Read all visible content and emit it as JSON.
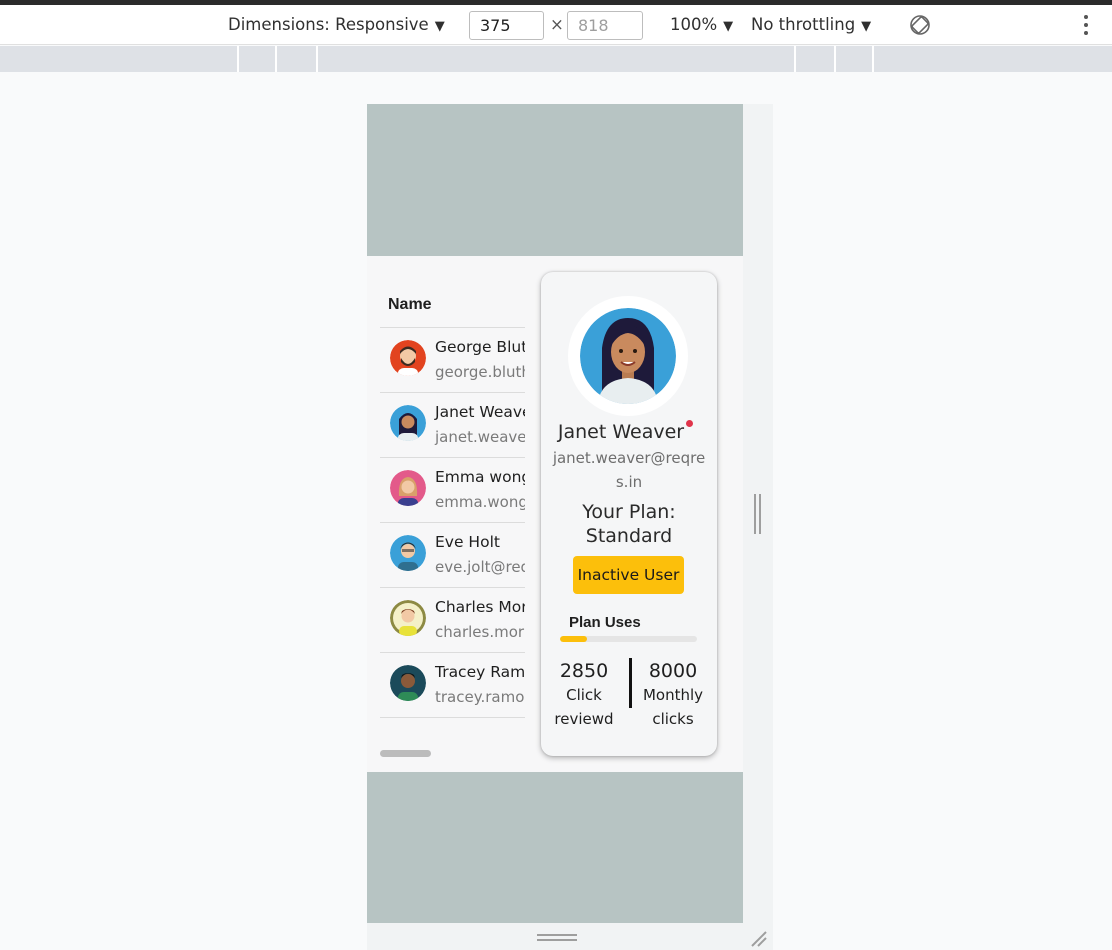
{
  "devtools": {
    "dimensions_label": "Dimensions: Responsive",
    "width_value": "375",
    "height_placeholder": "818",
    "times_symbol": "×",
    "zoom": "100%",
    "throttling": "No throttling",
    "caret": "▼"
  },
  "table": {
    "header_name": "Name",
    "rows": [
      {
        "name": "George Bluth",
        "email": "george.bluth@reqres.in",
        "avatar_color": "#e2431f",
        "icon": "avatar-george"
      },
      {
        "name": "Janet Weaver",
        "email": "janet.weaver@reqres.in",
        "avatar_color": "#3aa0d8",
        "icon": "avatar-janet"
      },
      {
        "name": "Emma wong",
        "email": "emma.wong@reqres.in",
        "avatar_color": "#e35a8a",
        "icon": "avatar-emma"
      },
      {
        "name": "Eve Holt",
        "email": "eve.jolt@reqres.in",
        "avatar_color": "#3aa0d8",
        "icon": "avatar-eve"
      },
      {
        "name": "Charles Morris",
        "email": "charles.morris@reqres.in",
        "avatar_color": "#8d8a43",
        "icon": "avatar-charles"
      },
      {
        "name": "Tracey Ramos",
        "email": "tracey.ramos@reqres.in",
        "avatar_color": "#1b4a5a",
        "icon": "avatar-tracey"
      }
    ]
  },
  "card": {
    "name": "Janet Weaver",
    "email": "janet.weaver@reqres.in",
    "plan_line1": "Your Plan:",
    "plan_line2": "Standard",
    "status_button": "Inactive User",
    "uses_label": "Plan Uses",
    "uses_fraction": 0.2,
    "stats": [
      {
        "value": "2850",
        "label_line1": "Click",
        "label_line2": "reviewd"
      },
      {
        "value": "8000",
        "label_line1": "Monthly",
        "label_line2": "clicks"
      }
    ]
  },
  "colors": {
    "accent": "#fcbf0b",
    "status_dot": "#e0344a",
    "viewport_bg": "#b7c4c3"
  }
}
